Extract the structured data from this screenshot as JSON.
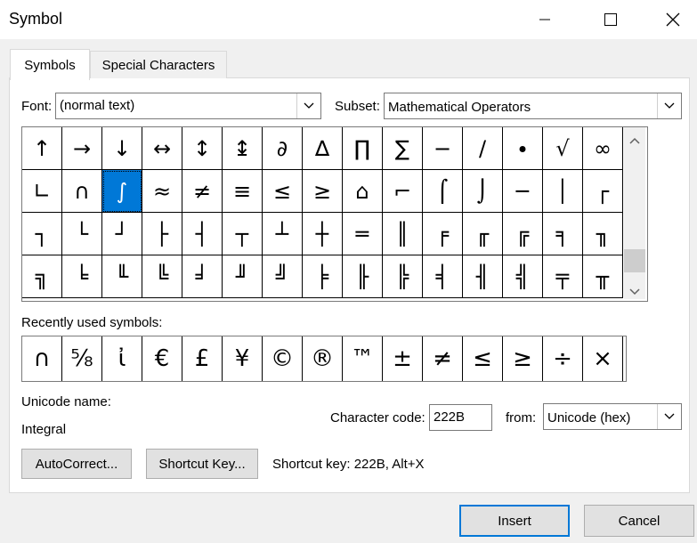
{
  "window": {
    "title": "Symbol"
  },
  "tabs": [
    {
      "label": "Symbols"
    },
    {
      "label": "Special Characters"
    }
  ],
  "font": {
    "label": "Font:",
    "value": "(normal text)"
  },
  "subset": {
    "label": "Subset:",
    "value": "Mathematical Operators"
  },
  "grid": {
    "rows": [
      [
        "↑",
        "→",
        "↓",
        "↔",
        "↕",
        "↨",
        "∂",
        "∆",
        "∏",
        "∑",
        "−",
        "∕",
        "∙",
        "√",
        "∞"
      ],
      [
        "∟",
        "∩",
        "∫",
        "≈",
        "≠",
        "≡",
        "≤",
        "≥",
        "⌂",
        "⌐",
        "⌠",
        "⌡",
        "─",
        "│",
        "┌"
      ],
      [
        "┐",
        "└",
        "┘",
        "├",
        "┤",
        "┬",
        "┴",
        "┼",
        "═",
        "║",
        "╒",
        "╓",
        "╔",
        "╕",
        "╖"
      ],
      [
        "╗",
        "╘",
        "╙",
        "╚",
        "╛",
        "╜",
        "╝",
        "╞",
        "╟",
        "╠",
        "╡",
        "╢",
        "╣",
        "╤",
        "╥"
      ]
    ],
    "selected": "∫"
  },
  "recent": {
    "label": "Recently used symbols:",
    "symbols": [
      "∩",
      "⅝",
      "ἰ",
      "€",
      "£",
      "¥",
      "©",
      "®",
      "™",
      "±",
      "≠",
      "≤",
      "≥",
      "÷",
      "×"
    ]
  },
  "unicode_name": {
    "label": "Unicode name:",
    "value": "Integral"
  },
  "char_code": {
    "label": "Character code:",
    "value": "222B"
  },
  "from": {
    "label": "from:",
    "value": "Unicode (hex)"
  },
  "buttons": {
    "autocorrect": "AutoCorrect...",
    "shortcut_key": "Shortcut Key...",
    "insert": "Insert",
    "cancel": "Cancel"
  },
  "shortcut_info": "Shortcut key: 222B, Alt+X"
}
